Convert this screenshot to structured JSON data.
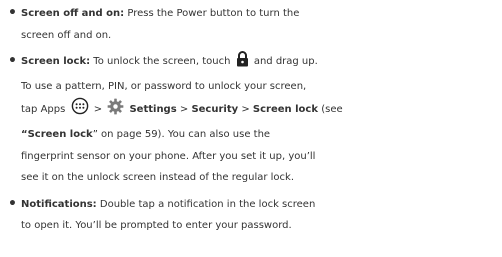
{
  "items": [
    {
      "title": "Screen off and on:",
      "lines": [
        "Press the Power button to turn the",
        "screen off and on."
      ]
    },
    {
      "title": "Screen lock:",
      "l1a": "To unlock the screen, touch",
      "l1b": "and drag up.",
      "l2": "To use a pattern, PIN, or password to unlock your screen,",
      "l3a": "tap Apps",
      "l3b": ">",
      "settings": "Settings",
      "gt1": ">",
      "security": "Security",
      "gt2": ">",
      "screen_lock": "Screen lock",
      "l3c": "(see",
      "q_link": "“Screen lock",
      "l4b": "” on page 59). You can also use the",
      "l5": "fingerprint sensor on your phone. After you set it up, you’ll",
      "l6": "see it on the unlock screen instead of the regular lock."
    },
    {
      "title": "Notifications:",
      "lines": [
        "Double tap a notification in the lock screen",
        "to open it. You’ll be prompted to enter your password."
      ]
    }
  ],
  "bullet": "•"
}
